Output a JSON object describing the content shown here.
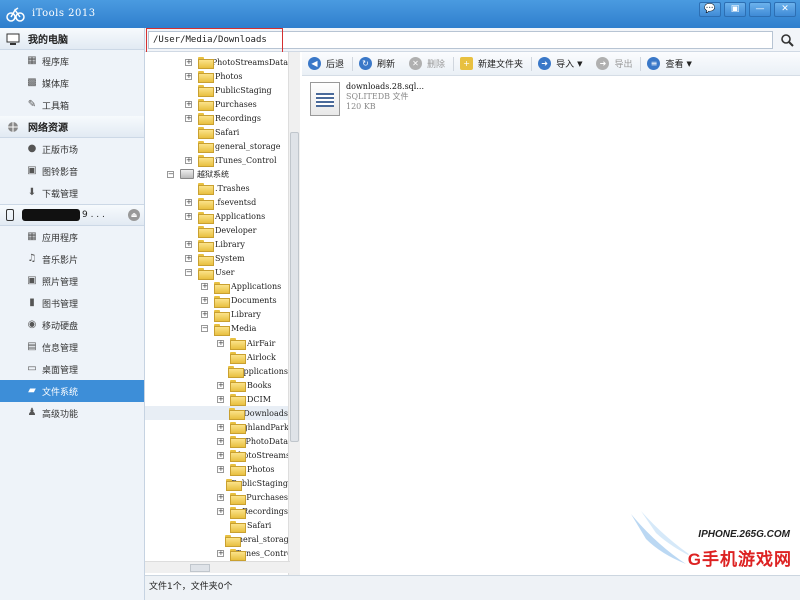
{
  "window": {
    "title": "iTools 2013",
    "buttons": [
      "💬",
      "▣",
      "—",
      "✕"
    ]
  },
  "sidebar": {
    "sections": [
      {
        "title": "我的电脑",
        "icon": "computer-icon",
        "items": [
          {
            "label": "程序库",
            "icon": "grid-icon"
          },
          {
            "label": "媒体库",
            "icon": "media-icon"
          },
          {
            "label": "工具箱",
            "icon": "wrench-icon"
          }
        ]
      },
      {
        "title": "网络资源",
        "icon": "globe-icon",
        "items": [
          {
            "label": "正版市场",
            "icon": "apple-icon"
          },
          {
            "label": "图铃影音",
            "icon": "photo-icon"
          },
          {
            "label": "下载管理",
            "icon": "download-icon"
          }
        ]
      }
    ],
    "device": {
      "name": "9 . . .",
      "items": [
        {
          "label": "应用程序",
          "icon": "apps-icon"
        },
        {
          "label": "音乐影片",
          "icon": "music-icon"
        },
        {
          "label": "照片管理",
          "icon": "photo-icon"
        },
        {
          "label": "图书管理",
          "icon": "book-icon"
        },
        {
          "label": "移动硬盘",
          "icon": "disk-icon"
        },
        {
          "label": "信息管理",
          "icon": "info-icon"
        },
        {
          "label": "桌面管理",
          "icon": "desktop-icon"
        },
        {
          "label": "文件系统",
          "icon": "folder-icon",
          "active": true
        },
        {
          "label": "高级功能",
          "icon": "advanced-icon"
        }
      ]
    }
  },
  "path": "/User/Media/Downloads",
  "tree": [
    {
      "label": "PhotoStreamsData",
      "level": 2,
      "exp": "+"
    },
    {
      "label": "Photos",
      "level": 2,
      "exp": "+"
    },
    {
      "label": "PublicStaging",
      "level": 2,
      "exp": ""
    },
    {
      "label": "Purchases",
      "level": 2,
      "exp": "+"
    },
    {
      "label": "Recordings",
      "level": 2,
      "exp": "+"
    },
    {
      "label": "Safari",
      "level": 2,
      "exp": ""
    },
    {
      "label": "general_storage",
      "level": 2,
      "exp": ""
    },
    {
      "label": "iTunes_Control",
      "level": 2,
      "exp": "+"
    },
    {
      "label": "越狱系统",
      "level": 1,
      "exp": "−",
      "drive": true
    },
    {
      "label": ".Trashes",
      "level": 2,
      "exp": ""
    },
    {
      "label": ".fseventsd",
      "level": 2,
      "exp": "+"
    },
    {
      "label": "Applications",
      "level": 2,
      "exp": "+"
    },
    {
      "label": "Developer",
      "level": 2,
      "exp": ""
    },
    {
      "label": "Library",
      "level": 2,
      "exp": "+"
    },
    {
      "label": "System",
      "level": 2,
      "exp": "+"
    },
    {
      "label": "User",
      "level": 2,
      "exp": "−"
    },
    {
      "label": "Applications",
      "level": 3,
      "exp": "+"
    },
    {
      "label": "Documents",
      "level": 3,
      "exp": "+"
    },
    {
      "label": "Library",
      "level": 3,
      "exp": "+"
    },
    {
      "label": "Media",
      "level": 3,
      "exp": "−"
    },
    {
      "label": "AirFair",
      "level": 4,
      "exp": "+"
    },
    {
      "label": "Airlock",
      "level": 4,
      "exp": ""
    },
    {
      "label": "Applications",
      "level": 4,
      "exp": ""
    },
    {
      "label": "Books",
      "level": 4,
      "exp": "+"
    },
    {
      "label": "DCIM",
      "level": 4,
      "exp": "+"
    },
    {
      "label": "Downloads",
      "level": 4,
      "exp": "",
      "selected": true
    },
    {
      "label": "HighlandPark",
      "level": 4,
      "exp": "+"
    },
    {
      "label": "PhotoData",
      "level": 4,
      "exp": "+"
    },
    {
      "label": "PhotoStreamsData",
      "level": 4,
      "exp": "+"
    },
    {
      "label": "Photos",
      "level": 4,
      "exp": "+"
    },
    {
      "label": "PublicStaging",
      "level": 4,
      "exp": ""
    },
    {
      "label": "Purchases",
      "level": 4,
      "exp": "+"
    },
    {
      "label": "Recordings",
      "level": 4,
      "exp": "+"
    },
    {
      "label": "Safari",
      "level": 4,
      "exp": ""
    },
    {
      "label": "general_storage",
      "level": 4,
      "exp": ""
    },
    {
      "label": "iTunes_Control",
      "level": 4,
      "exp": "+"
    }
  ],
  "toolbar": {
    "back": "后退",
    "refresh": "刷新",
    "delete": "删除",
    "new_folder": "新建文件夹",
    "import": "导入",
    "export": "导出",
    "view": "查看"
  },
  "colors": {
    "accent": "#3d8ed8",
    "back": "#3a78c8",
    "refresh": "#3a78c8",
    "delete": "#b0b0b0",
    "import": "#3a78c8",
    "export": "#b0b0b0",
    "view": "#3a78c8"
  },
  "files": [
    {
      "name": "downloads.28.sql...",
      "type": "SQLITEDB 文件",
      "size": "120 KB"
    }
  ],
  "status": "文件1个，文件夹0个",
  "watermark": {
    "top": "IPHONE.265G.COM",
    "main": "G手机游戏网"
  }
}
